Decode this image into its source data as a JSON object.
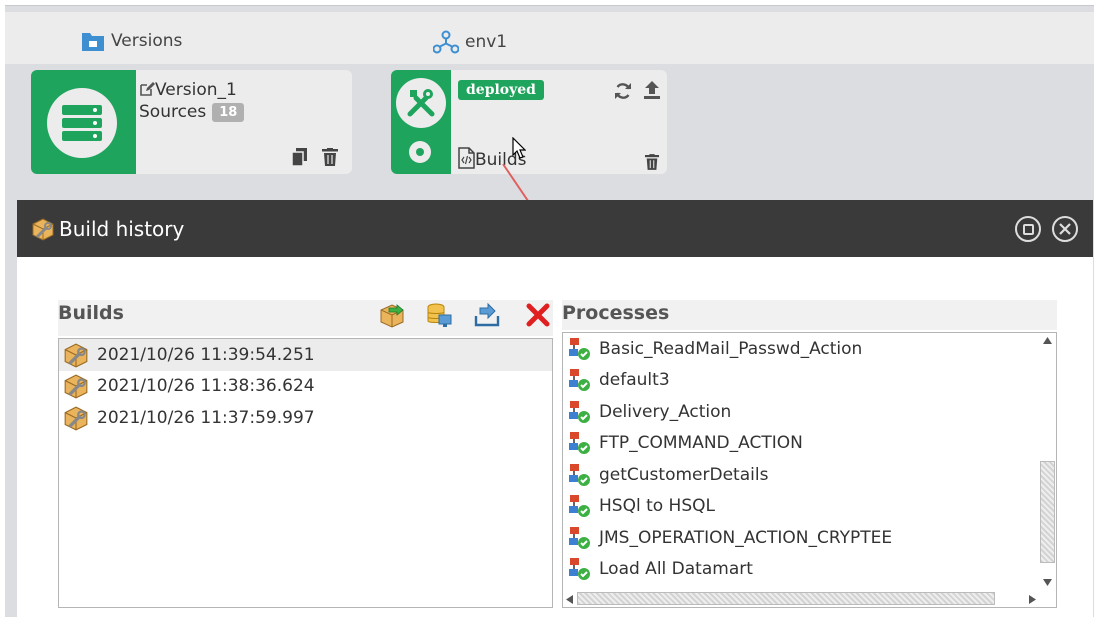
{
  "header": {
    "versions_label": "Versions",
    "env_label": "env1"
  },
  "version_card": {
    "name": "Version_1",
    "sources_label": "Sources",
    "sources_count": "18"
  },
  "env_card": {
    "status_badge": "deployed",
    "builds_label": "Builds"
  },
  "modal": {
    "title": "Build history",
    "builds_panel_title": "Builds",
    "processes_panel_title": "Processes",
    "builds": [
      "2021/10/26 11:39:54.251",
      "2021/10/26 11:38:36.624",
      "2021/10/26 11:37:59.997"
    ],
    "processes": [
      "Basic_ReadMail_Passwd_Action",
      "default3",
      "Delivery_Action",
      "FTP_COMMAND_ACTION",
      "getCustomerDetails",
      "HSQl to HSQL",
      "JMS_OPERATION_ACTION_CRYPTEE",
      "Load All Datamart"
    ]
  },
  "colors": {
    "accent_green": "#1fa45d",
    "modal_header": "#3a3a3a",
    "delete_red": "#e02020",
    "arrow": "#e06060"
  }
}
